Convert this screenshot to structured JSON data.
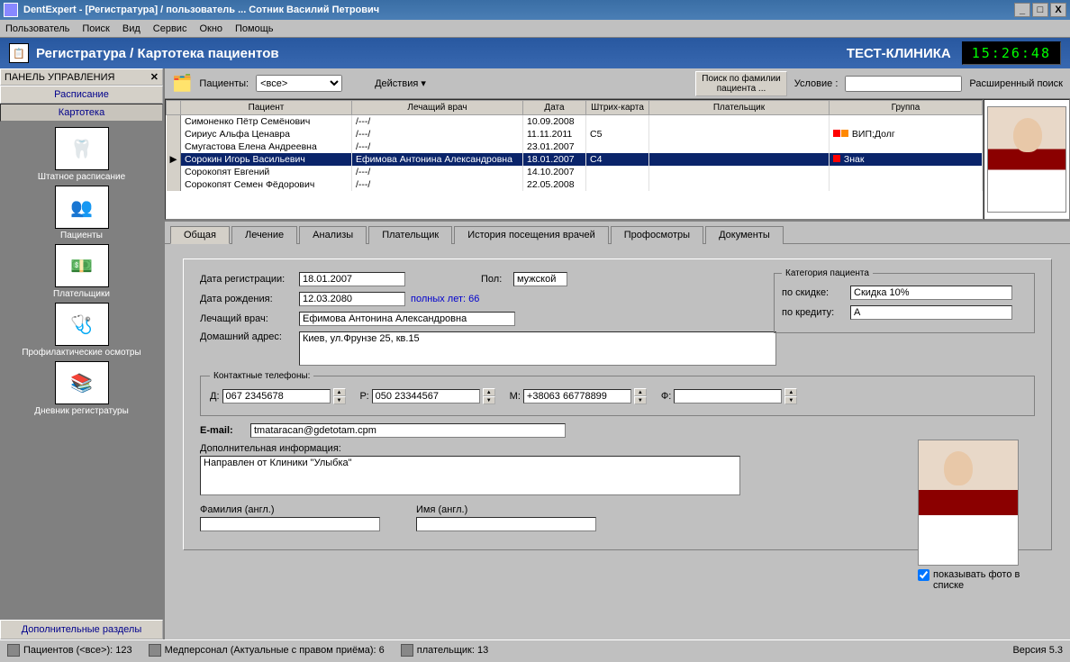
{
  "window": {
    "title": "DentExpert - [Регистратура]   / пользователь ... Сотник Василий Петрович"
  },
  "menu": [
    "Пользователь",
    "Поиск",
    "Вид",
    "Сервис",
    "Окно",
    "Помощь"
  ],
  "header": {
    "title": "Регистратура / Картотека пациентов",
    "clinic": "ТЕСТ-КЛИНИКА",
    "clock": "15:26:48"
  },
  "sidepanel": {
    "title": "ПАНЕЛЬ УПРАВЛЕНИЯ",
    "categories": [
      "Расписание",
      "Картотека"
    ],
    "active_category": 1,
    "items": [
      {
        "label": "Штатное расписание",
        "glyph": "🦷"
      },
      {
        "label": "Пациенты",
        "glyph": "👥"
      },
      {
        "label": "Плательщики",
        "glyph": "💵"
      },
      {
        "label": "Профилактические осмотры",
        "glyph": "🩺"
      },
      {
        "label": "Дневник регистратуры",
        "glyph": "📚"
      }
    ],
    "footer": "Дополнительные разделы"
  },
  "toolbar": {
    "patients_label": "Пациенты:",
    "patients_filter": "<все>",
    "actions_label": "Действия",
    "search_button": "Поиск по фамилии\nпациента ...",
    "condition_label": "Условие :",
    "condition_value": "",
    "extended": "Расширенный поиск"
  },
  "grid": {
    "columns": [
      "Пациент",
      "Лечащий врач",
      "Дата",
      "Штрих-карта",
      "Плательщик",
      "Группа"
    ],
    "rows": [
      {
        "patient": "Симоненко Пётр Семёнович",
        "doctor": "/---/",
        "date": "10.09.2008",
        "barcode": "",
        "payer": "",
        "group": "",
        "colors": []
      },
      {
        "patient": "Сириус Альфа Ценавра",
        "doctor": "/---/",
        "date": "11.11.2011",
        "barcode": "C5",
        "payer": "",
        "group": "ВИП;Долг",
        "colors": [
          "#f00",
          "#f80"
        ]
      },
      {
        "patient": "Смугастова Елена Андреевна",
        "doctor": "/---/",
        "date": "23.01.2007",
        "barcode": "",
        "payer": "",
        "group": "",
        "colors": []
      },
      {
        "patient": "Сорокин Игорь Васильевич",
        "doctor": "Ефимова Антонина Александровна",
        "date": "18.01.2007",
        "barcode": "C4",
        "payer": "",
        "group": "Знак",
        "colors": [
          "#f00"
        ]
      },
      {
        "patient": "Сорокопят Евгений",
        "doctor": "/---/",
        "date": "14.10.2007",
        "barcode": "",
        "payer": "",
        "group": "",
        "colors": []
      },
      {
        "patient": "Сорокопят Семен Фёдорович",
        "doctor": "/---/",
        "date": "22.05.2008",
        "barcode": "",
        "payer": "",
        "group": "",
        "colors": []
      }
    ],
    "selected": 3
  },
  "tabs": [
    "Общая",
    "Лечение",
    "Анализы",
    "Плательщик",
    "История посещения врачей",
    "Профосмотры",
    "Документы"
  ],
  "active_tab": 0,
  "form": {
    "reg_date_label": "Дата регистрации:",
    "reg_date": "18.01.2007",
    "sex_label": "Пол:",
    "sex": "мужской",
    "birth_label": "Дата рождения:",
    "birth": "12.03.2080",
    "age_label": "полных лет: 66",
    "doctor_label": "Лечащий врач:",
    "doctor": "Ефимова Антонина Александровна",
    "address_label": "Домашний адрес:",
    "address": "Киев, ул.Фрунзе 25, кв.15",
    "phones_legend": "Контактные телефоны:",
    "phone_d_label": "Д:",
    "phone_d": "067 2345678",
    "phone_r_label": "Р:",
    "phone_r": "050 23344567",
    "phone_m_label": "М:",
    "phone_m": "+38063 66778899",
    "phone_f_label": "Ф:",
    "phone_f": "",
    "email_label": "E-mail:",
    "email": "tmataracan@gdetotam.cpm",
    "extra_label": "Дополнительная информация:",
    "extra": "Направлен от Клиники \"Улыбка\"",
    "lname_en_label": "Фамилия (англ.)",
    "lname_en": "",
    "fname_en_label": "Имя (англ.)",
    "fname_en": "",
    "category_legend": "Категория пациента",
    "discount_label": "по скидке:",
    "discount": "Скидка 10%",
    "credit_label": "по кредиту:",
    "credit": "А",
    "show_photo_label": "показывать фото в списке",
    "show_photo": true
  },
  "statusbar": {
    "patients": "Пациентов (<все>): 123",
    "staff": "Медперсонал (Актуальные с правом приёма): 6",
    "payer": "плательщик: 13",
    "version": "Версия 5.3"
  }
}
